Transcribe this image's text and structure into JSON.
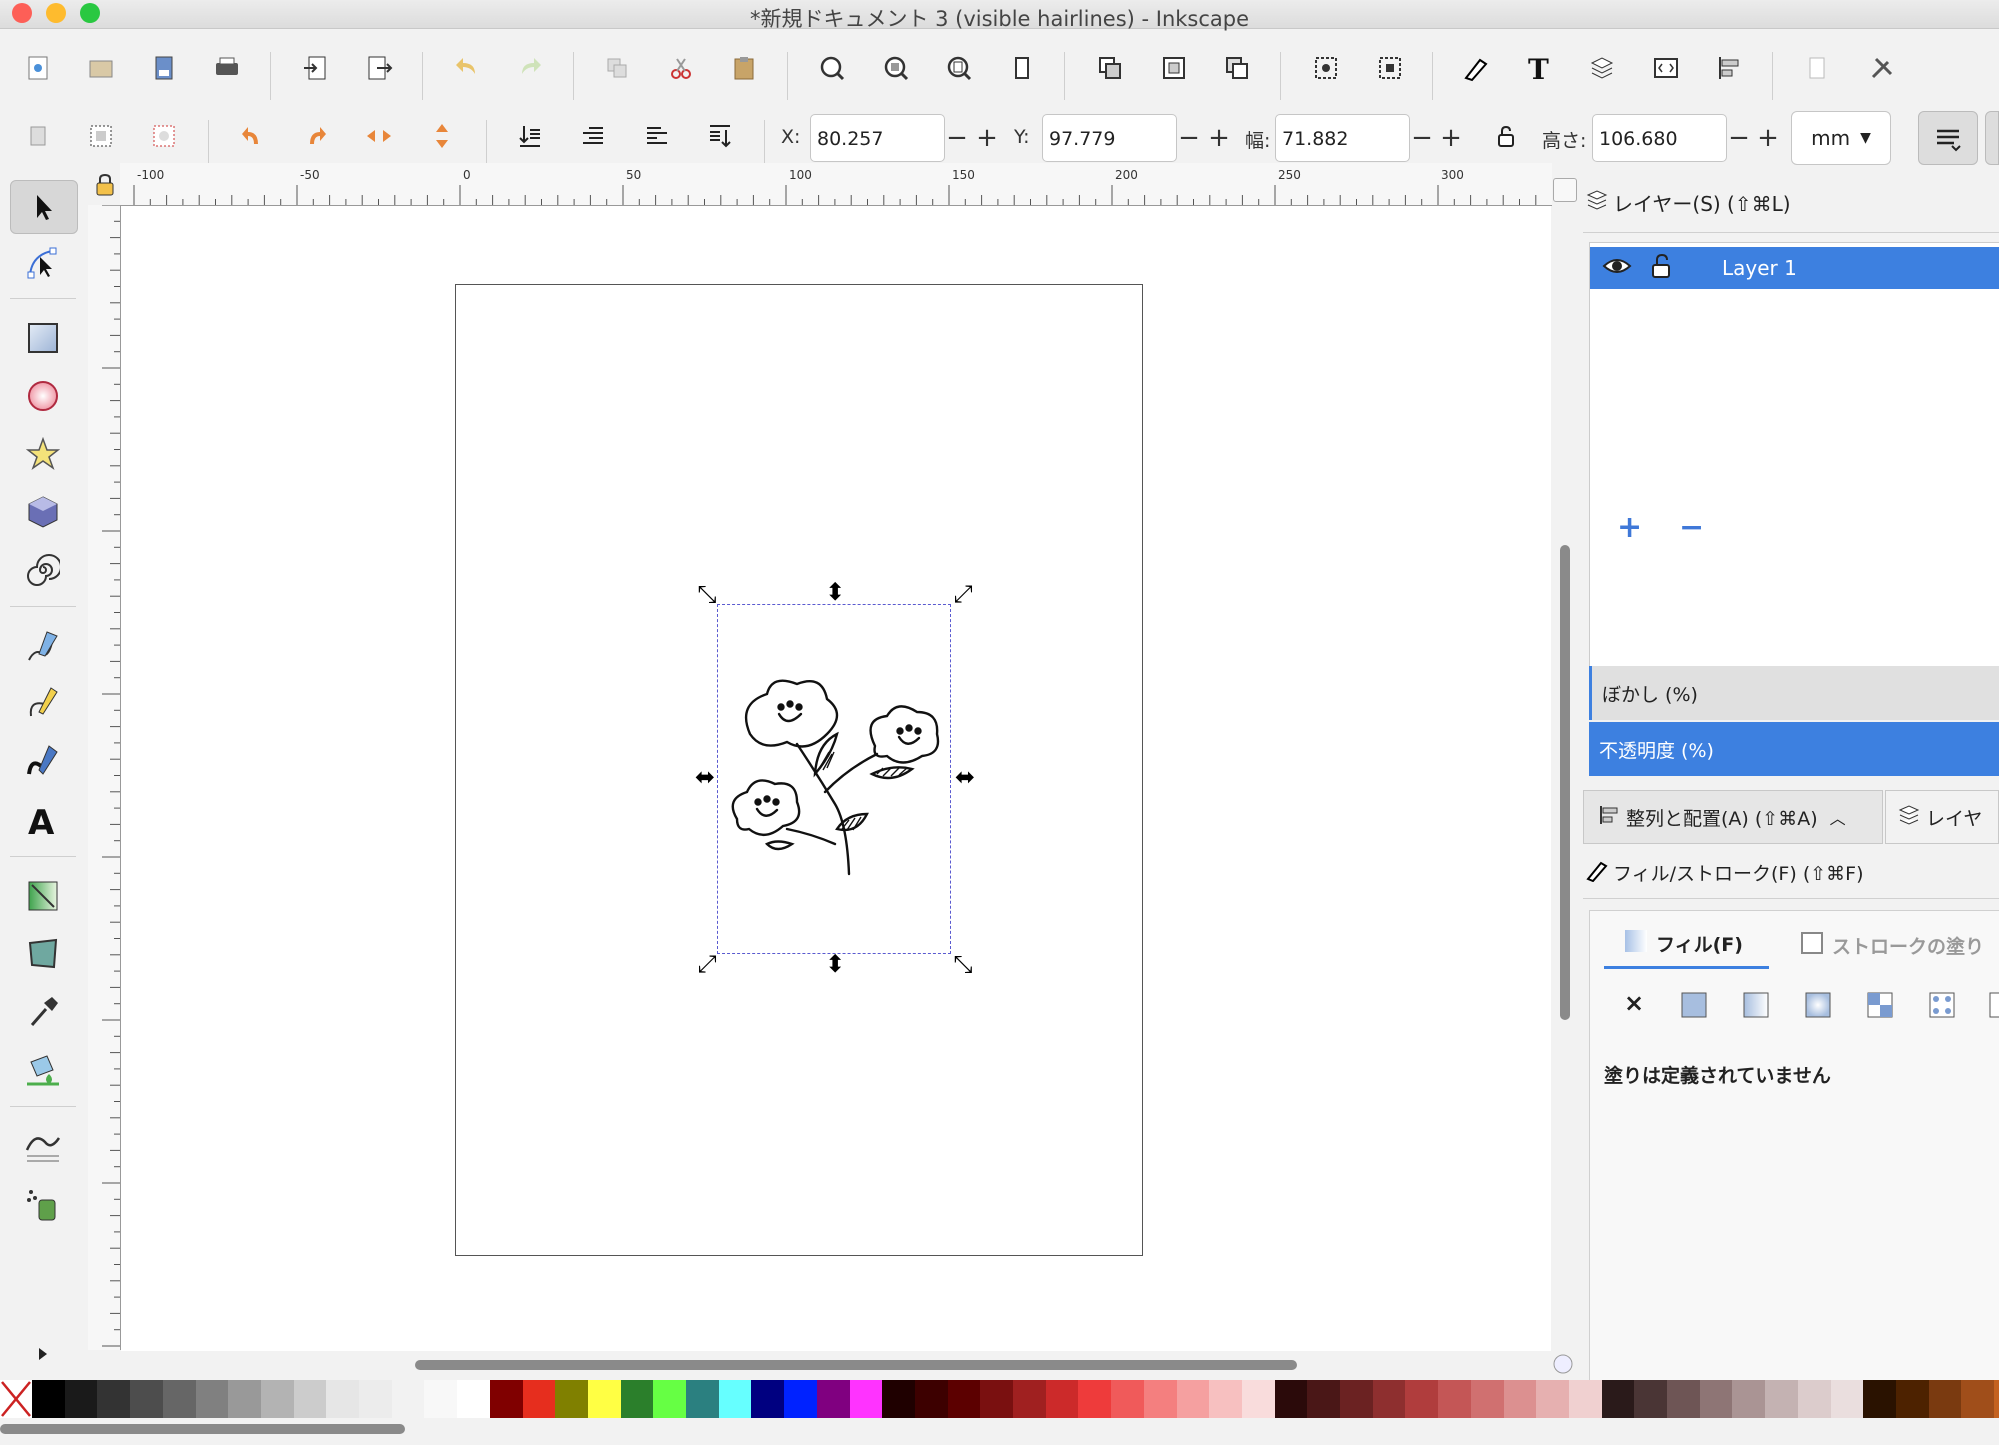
{
  "window": {
    "title": "*新規ドキュメント 3 (visible hairlines) - Inkscape"
  },
  "toolbar_main": {
    "icons": [
      "new-document",
      "open",
      "save",
      "print",
      "import",
      "export",
      "undo",
      "redo",
      "duplicate",
      "cut",
      "paste",
      "zoom-selection",
      "zoom-drawing",
      "zoom-page",
      "zoom-page-width",
      "group",
      "ungroup",
      "clone",
      "make-bitmap",
      "trace",
      "xml-editor",
      "text-tool",
      "layers",
      "object-properties",
      "align-distribute",
      "preferences",
      "document-properties"
    ]
  },
  "toolbar_select": {
    "x_label": "X:",
    "x_value": "80.257",
    "y_label": "Y:",
    "y_value": "97.779",
    "w_label": "幅:",
    "w_value": "71.882",
    "h_label": "高さ:",
    "h_value": "106.680",
    "unit": "mm",
    "minus": "−",
    "plus": "+"
  },
  "ruler": {
    "labels": [
      "-100",
      "-50",
      "0",
      "50",
      "100",
      "150",
      "200",
      "250",
      "300"
    ]
  },
  "tools": [
    "selector",
    "node",
    "rectangle",
    "ellipse",
    "star",
    "3d-box",
    "spiral",
    "pencil",
    "pen",
    "calligraphy",
    "text",
    "gradient",
    "mesh",
    "dropper",
    "paint-bucket",
    "tweak",
    "spray",
    "more"
  ],
  "dock": {
    "layers_title": "レイヤー(S) (⇧⌘L)",
    "layer_name": "Layer 1",
    "add": "+",
    "remove": "−",
    "blur_label": "ぼかし (%)",
    "opacity_label": "不透明度 (%)",
    "align_tab": "整列と配置(A) (⇧⌘A)",
    "layers_tab": "レイヤ",
    "fill_stroke_title": "フィル/ストローク(F) (⇧⌘F)",
    "fill_tab": "フィル(F)",
    "stroke_tab": "ストロークの塗り",
    "no_paint_x": "×",
    "no_fill_text": "塗りは定義されていません"
  },
  "palette": {
    "colors": [
      "#000000",
      "#1a1a1a",
      "#333333",
      "#4d4d4d",
      "#666666",
      "#808080",
      "#999999",
      "#b3b3b3",
      "#cccccc",
      "#e6e6e6",
      "#ececec",
      "#f2f2f2",
      "#f8f8f8",
      "#ffffff",
      "#800000",
      "#e62e1e",
      "#808000",
      "#ffff44",
      "#2b7f2b",
      "#66ff44",
      "#2b8080",
      "#66ffff",
      "#000080",
      "#0022ff",
      "#800080",
      "#ff33ff",
      "#1f0000",
      "#3d0000",
      "#5c0000",
      "#7a1010",
      "#a02020",
      "#cc2a2a",
      "#ee3b3b",
      "#f05a5a",
      "#f47f7f",
      "#f5a0a0",
      "#f7c0c0",
      "#f9dcdc",
      "#2b0a0a",
      "#4a1717",
      "#6b2222",
      "#8e2f2f",
      "#b03d3d",
      "#c45656",
      "#d07070",
      "#dc9090",
      "#e6b0b0",
      "#f0d0d0",
      "#2a1a1a",
      "#4a3535",
      "#6e5555",
      "#8e7575",
      "#aa9494",
      "#c4b2b2",
      "#dccccc",
      "#eadede",
      "#2a1200",
      "#4d2200",
      "#7a3a10",
      "#a04e1a",
      "#c46220",
      "#e27530",
      "#f08a3a"
    ]
  }
}
